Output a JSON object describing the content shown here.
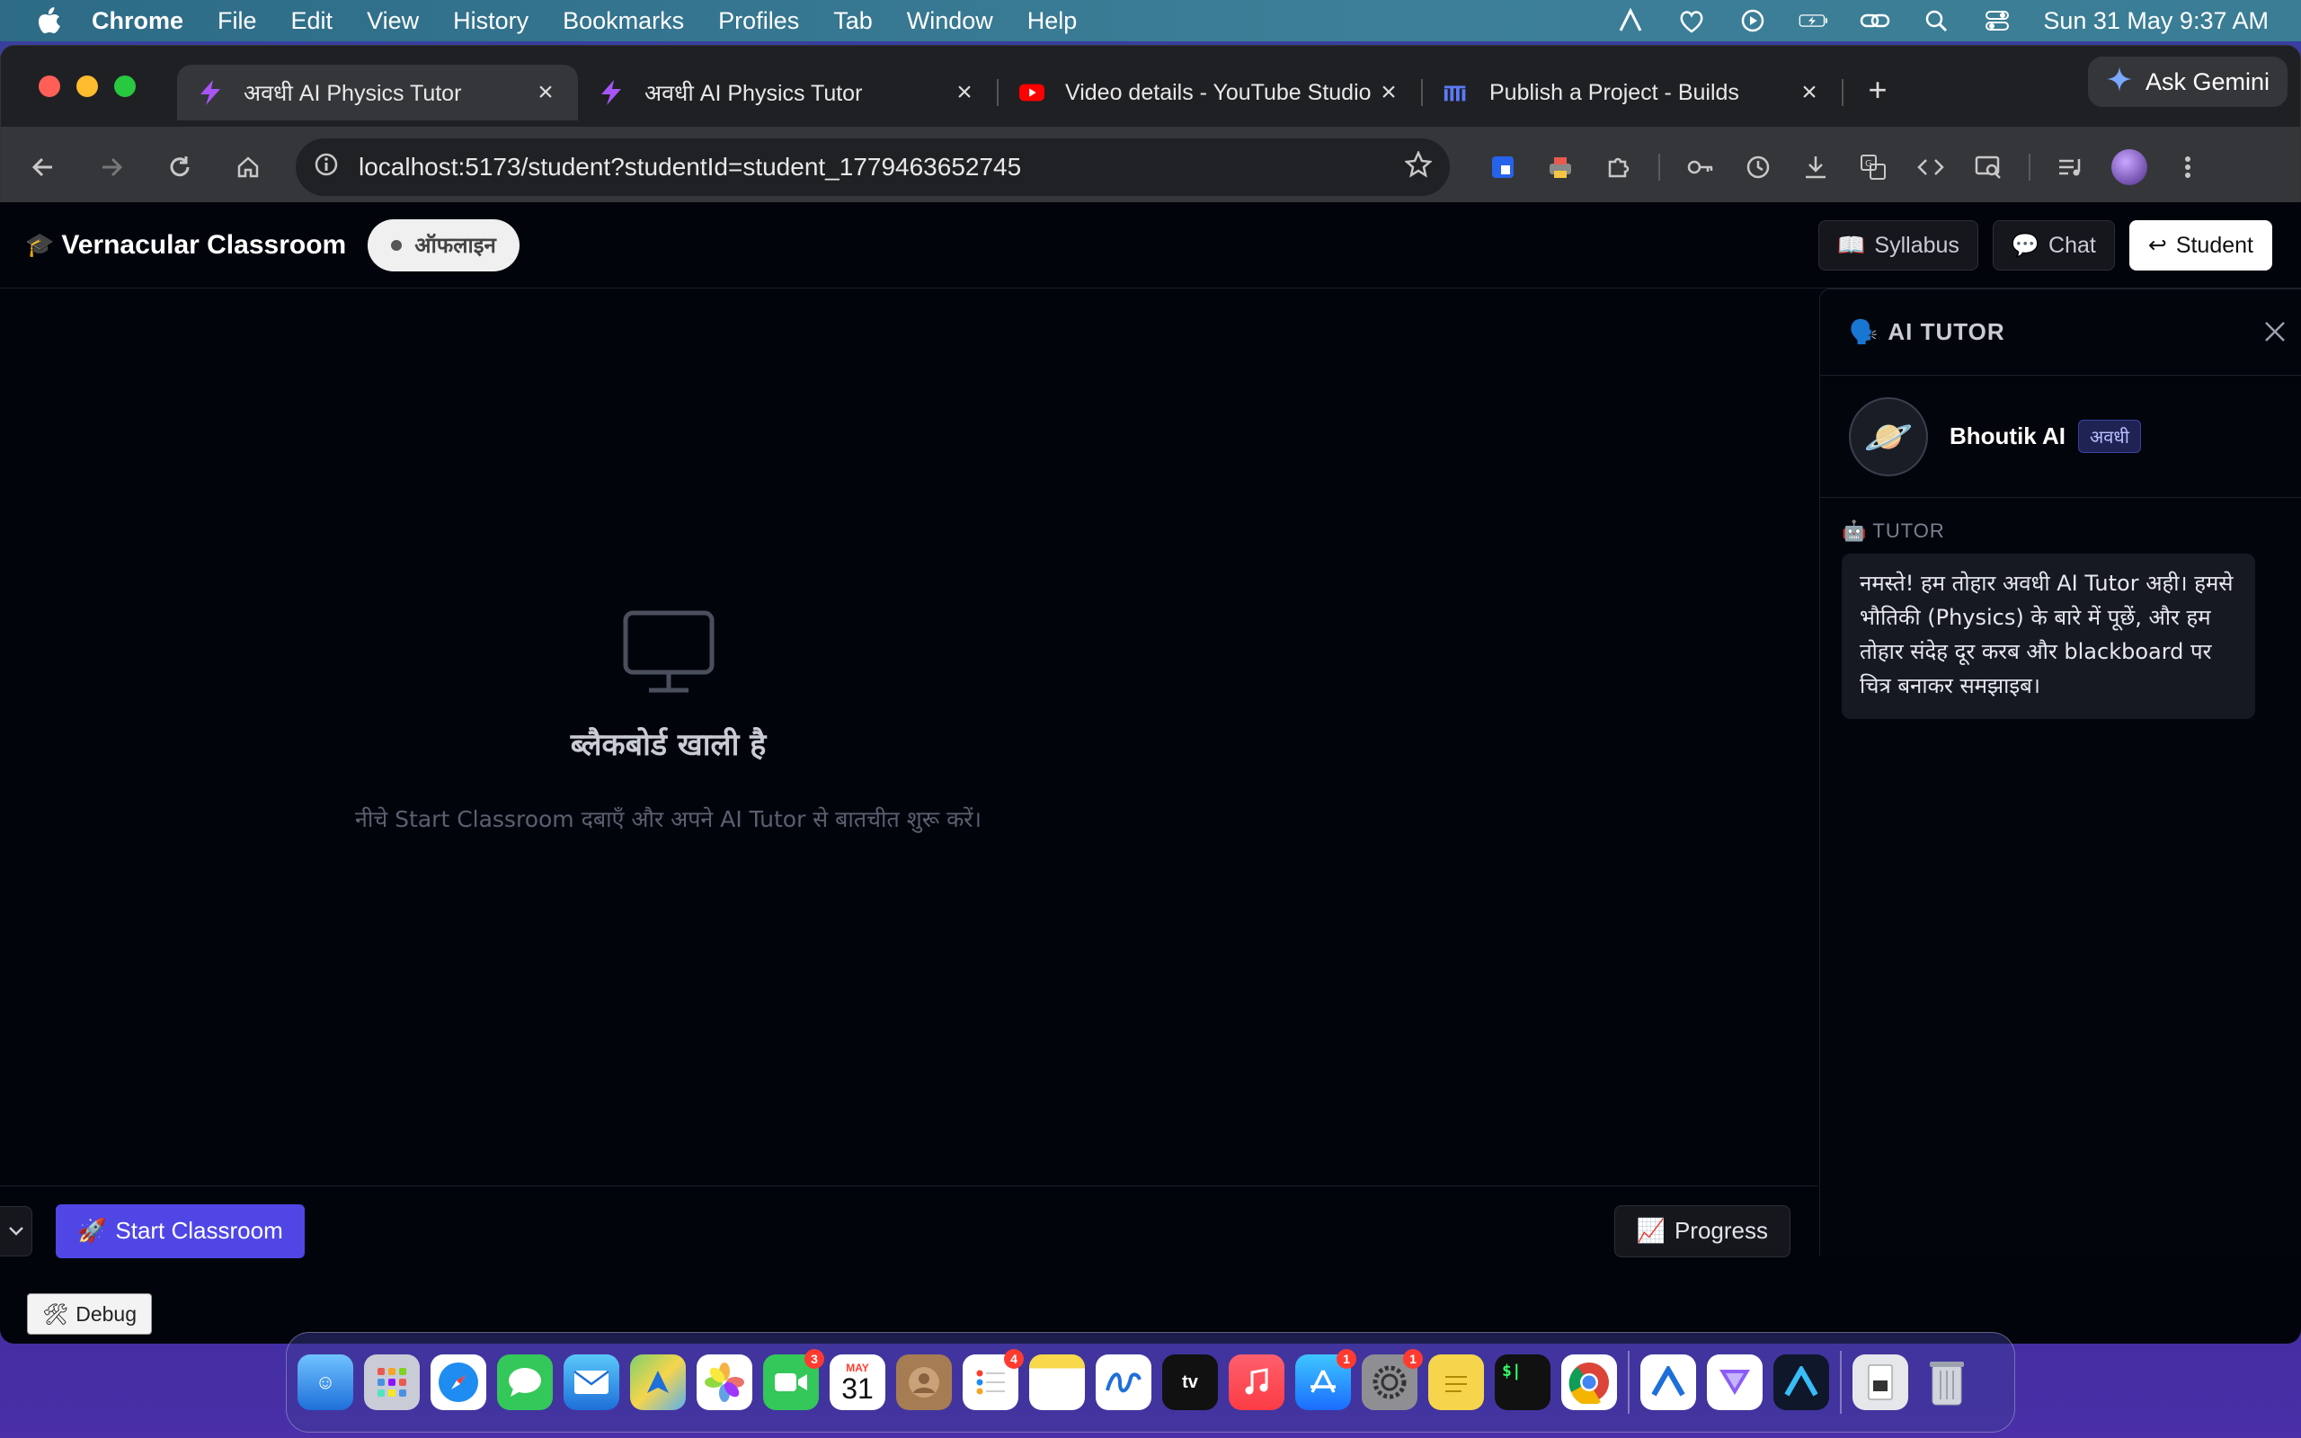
{
  "menubar": {
    "app_name": "Chrome",
    "menus": [
      "File",
      "Edit",
      "View",
      "History",
      "Bookmarks",
      "Profiles",
      "Tab",
      "Window",
      "Help"
    ],
    "clock": "Sun 31 May  9:37 AM"
  },
  "browser": {
    "tabs": [
      {
        "title": "अवधी AI Physics Tutor",
        "active": true,
        "icon": "bolt-icon"
      },
      {
        "title": "अवधी AI Physics Tutor",
        "active": false,
        "icon": "bolt-icon"
      },
      {
        "title": "Video details - YouTube Studio",
        "active": false,
        "icon": "youtube-icon"
      },
      {
        "title": "Publish a Project - Builds",
        "active": false,
        "icon": "builds-icon"
      }
    ],
    "ask_gemini": "Ask Gemini",
    "url": "localhost:5173/student?studentId=student_1779463652745"
  },
  "app": {
    "brand": "Vernacular Classroom",
    "status": "ऑफलाइन",
    "header_buttons": {
      "syllabus": "Syllabus",
      "chat": "Chat",
      "student": "Student"
    },
    "blackboard": {
      "title": "ब्लैकबोर्ड खाली है",
      "subtitle": "नीचे Start Classroom दबाएँ और अपने AI Tutor से बातचीत शुरू करें।"
    },
    "start_button": "Start Classroom",
    "progress_button": "Progress",
    "debug_button": "Debug"
  },
  "tutor_panel": {
    "title": "AI TUTOR",
    "tutor_name": "Bhoutik AI",
    "language": "अवधी",
    "messages": [
      {
        "role": "TUTOR",
        "text": "नमस्ते! हम तोहार अवधी AI Tutor अही। हमसे भौतिकी (Physics) के बारे में पूछें, और हम तोहार संदेह दूर करब और blackboard पर चित्र बनाकर समझाइब।"
      }
    ]
  },
  "dock": {
    "badges": {
      "facetime": "3",
      "reminders": "4",
      "appstore": "1",
      "settings": "1"
    },
    "calendar_month": "MAY",
    "calendar_day": "31"
  },
  "colors": {
    "accent": "#4f46e5",
    "page_bg": "#02040c",
    "badge_bg": "#1e2353"
  }
}
